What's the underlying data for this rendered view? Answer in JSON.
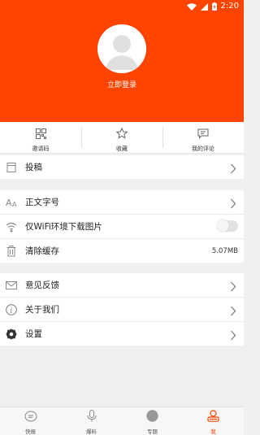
{
  "status_bar": {
    "time": "2:20",
    "icons": [
      "wifi-icon",
      "signal-icon",
      "battery-icon"
    ]
  },
  "header": {
    "login_label": "立即登录",
    "avatar_icon": "default-avatar-icon"
  },
  "quick_actions": [
    {
      "label": "邀请码",
      "icon": "qrcode-icon"
    },
    {
      "label": "收藏",
      "icon": "star-icon"
    },
    {
      "label": "我的评论",
      "icon": "comment-icon"
    }
  ],
  "menu": {
    "submit": {
      "label": "投稿",
      "icon": "document-icon"
    },
    "font_size": {
      "label": "正文字号",
      "icon": "font-size-icon"
    },
    "wifi_images": {
      "label": "仅WiFi环境下载图片",
      "icon": "wifi-icon",
      "enabled": false
    },
    "clear_cache": {
      "label": "清除缓存",
      "icon": "trash-icon",
      "value": "5.07MB"
    },
    "feedback": {
      "label": "意见反馈",
      "icon": "mail-icon"
    },
    "about": {
      "label": "关于我们",
      "icon": "info-icon"
    },
    "settings": {
      "label": "设置",
      "icon": "gear-icon"
    }
  },
  "tabs": [
    {
      "label": "快报",
      "icon": "news-icon"
    },
    {
      "label": "爆料",
      "icon": "microphone-icon"
    },
    {
      "label": "专题",
      "icon": "topic-circle-icon"
    },
    {
      "label": "我",
      "icon": "profile-icon",
      "active": true
    }
  ],
  "colors": {
    "accent": "#ff4400",
    "background": "#f0f0f0"
  }
}
